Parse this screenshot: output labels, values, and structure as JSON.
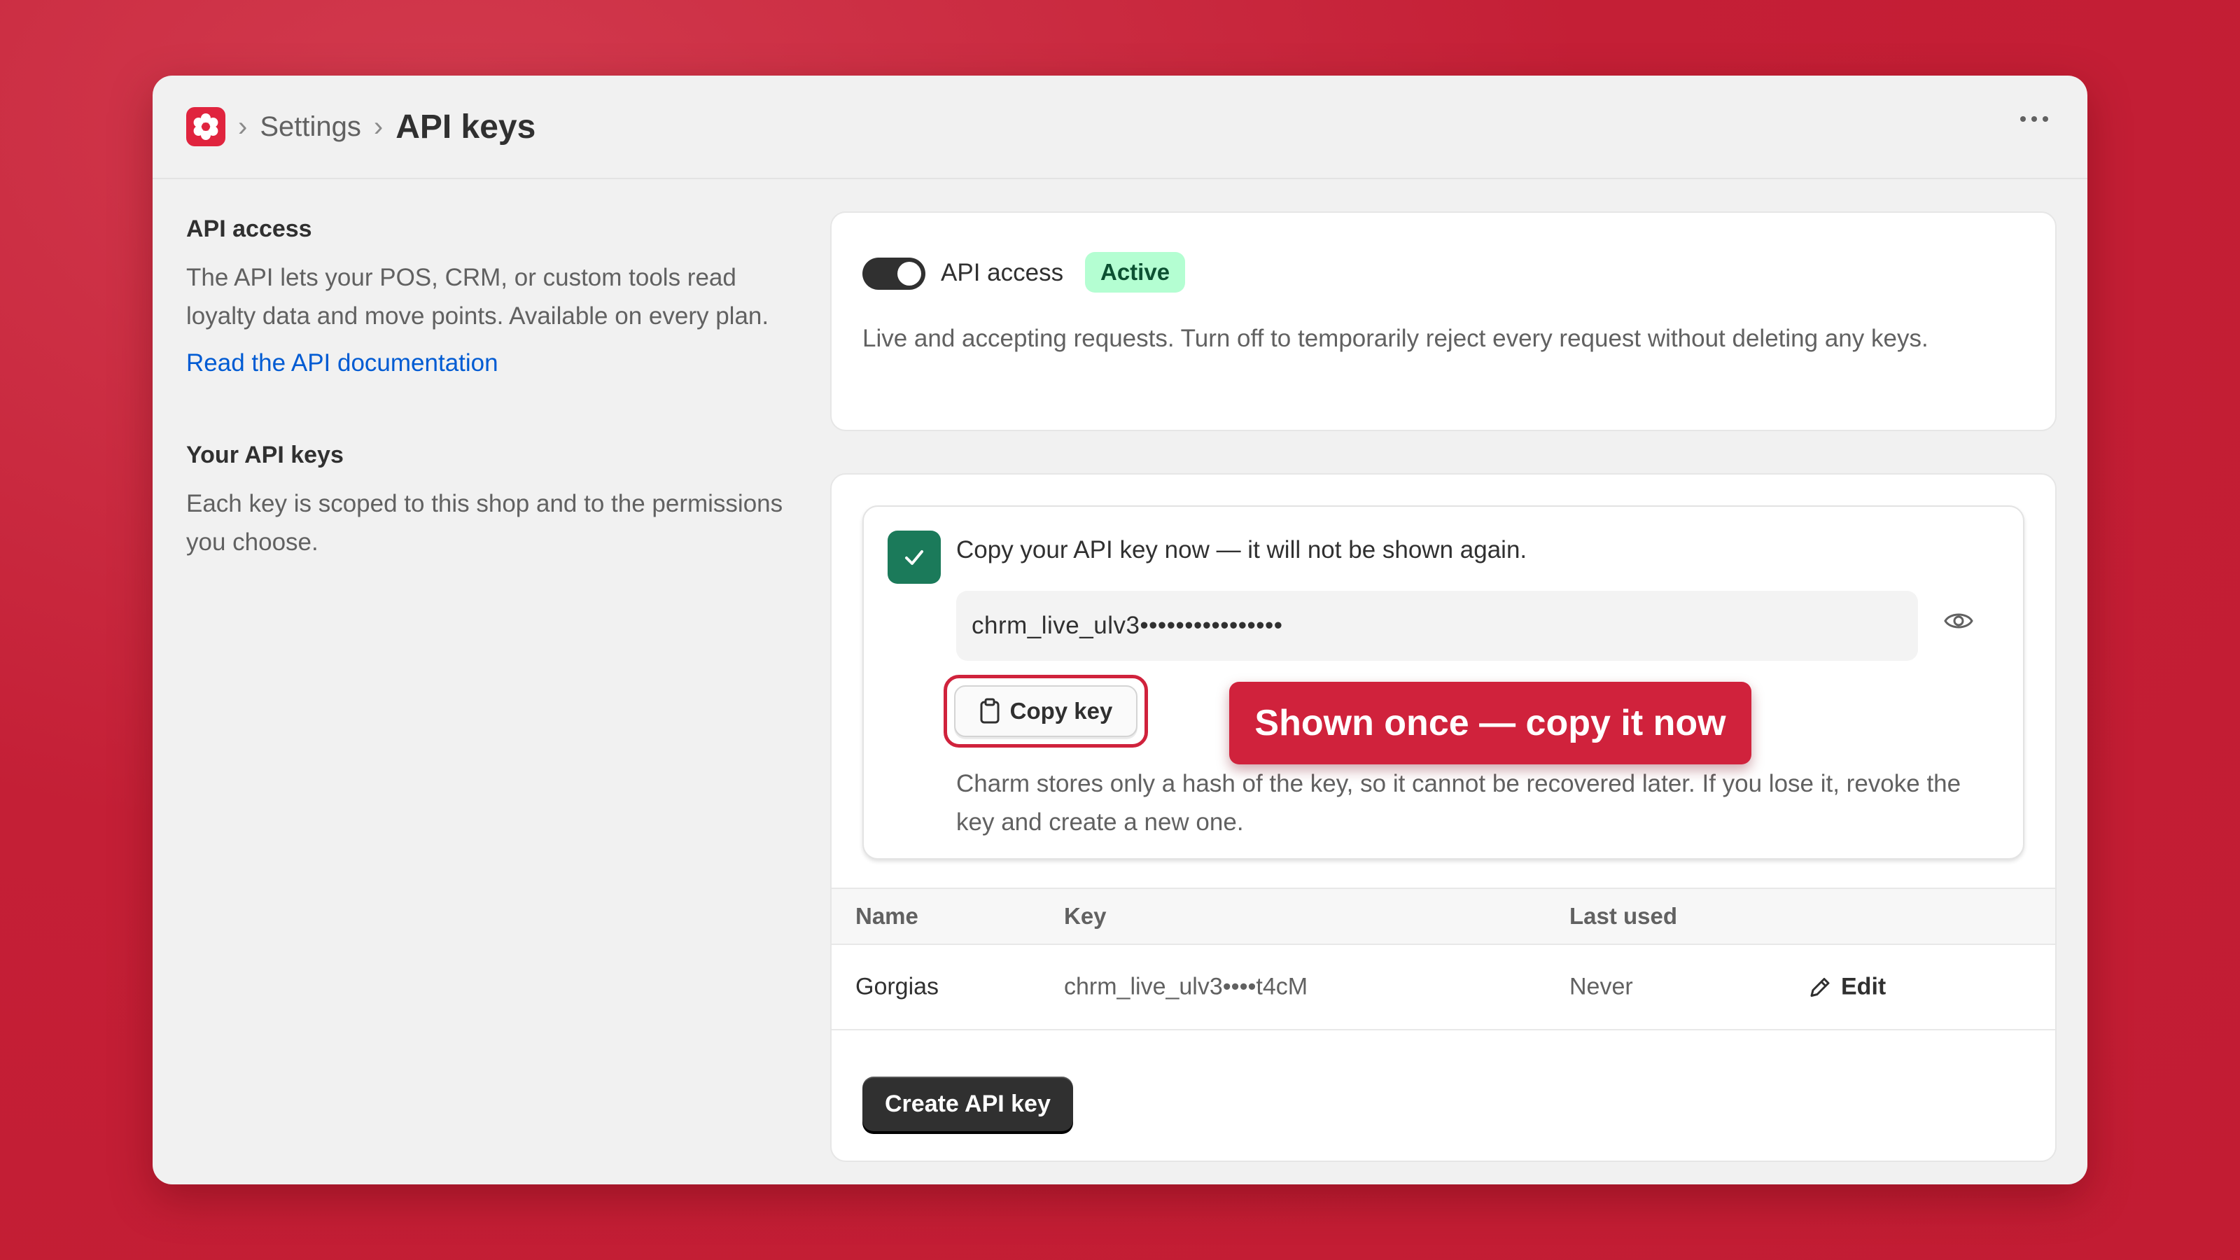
{
  "header": {
    "logo_icon": "flower-gear-icon",
    "breadcrumb": [
      "Settings"
    ],
    "title": "API keys",
    "more_icon": "more-horizontal-icon"
  },
  "left_panel": {
    "access": {
      "title": "API access",
      "text": "The API lets your POS, CRM, or custom tools read loyalty data and move points. Available on every plan.",
      "link": "Read the API documentation"
    },
    "keys": {
      "title": "Your API keys",
      "text": "Each key is scoped to this shop and to the permissions you choose."
    }
  },
  "access_card": {
    "toggle_on": true,
    "label": "API access",
    "badge": "Active",
    "description": "Live and accepting requests. Turn off to temporarily reject every request without deleting any keys."
  },
  "new_key_banner": {
    "title": "Copy your API key now — it will not be shown again.",
    "key_value": "chrm_live_ulv3••••••••••••••••",
    "copy_label": "Copy key",
    "callout": "Shown once — copy it now",
    "note": "Charm stores only a hash of the key, so it cannot be recovered later. If you lose it, revoke the key and create a new one."
  },
  "table": {
    "columns": [
      "Name",
      "Key",
      "Last used"
    ],
    "rows": [
      {
        "name": "Gorgias",
        "key": "chrm_live_ulv3••••t4cM",
        "last_used": "Never",
        "action": "Edit"
      }
    ]
  },
  "create_button": "Create API key",
  "colors": {
    "background": "#c41f36",
    "accent": "#d0223c",
    "success": "#1b7a5a",
    "badge_bg": "#b4fed2",
    "link": "#005bd3"
  }
}
